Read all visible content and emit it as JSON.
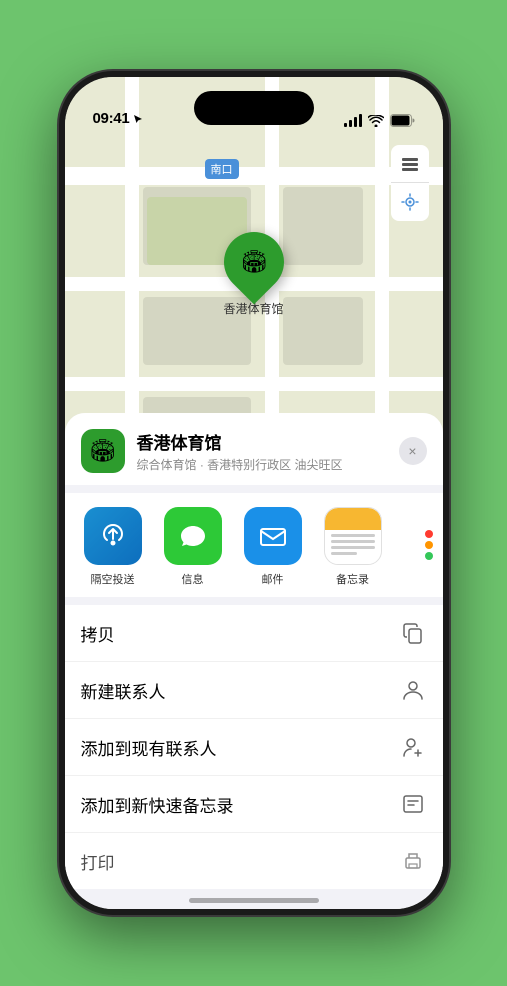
{
  "status_bar": {
    "time": "09:41",
    "time_icon": "location-arrow-icon"
  },
  "map": {
    "label": "南口",
    "label_prefix": "南口"
  },
  "location_pin": {
    "label": "香港体育馆"
  },
  "sheet": {
    "venue_name": "香港体育馆",
    "venue_sub": "综合体育馆 · 香港特别行政区 油尖旺区",
    "close_label": "×"
  },
  "share_apps": [
    {
      "id": "airdrop",
      "label": "隔空投送",
      "selected": false
    },
    {
      "id": "messages",
      "label": "信息",
      "selected": false
    },
    {
      "id": "mail",
      "label": "邮件",
      "selected": false
    },
    {
      "id": "notes",
      "label": "备忘录",
      "selected": true
    }
  ],
  "actions": [
    {
      "id": "copy",
      "label": "拷贝",
      "icon": "copy-icon"
    },
    {
      "id": "new-contact",
      "label": "新建联系人",
      "icon": "person-icon"
    },
    {
      "id": "add-existing",
      "label": "添加到现有联系人",
      "icon": "person-add-icon"
    },
    {
      "id": "add-note",
      "label": "添加到新快速备忘录",
      "icon": "note-icon"
    },
    {
      "id": "print",
      "label": "打印",
      "icon": "print-icon"
    }
  ],
  "more_dots": {
    "colors": [
      "#ff3b30",
      "#ff9500",
      "#34c759"
    ]
  }
}
